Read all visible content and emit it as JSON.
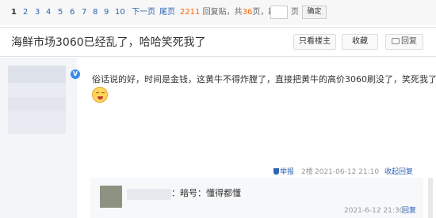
{
  "pager": {
    "pages": [
      "1",
      "2",
      "3",
      "4",
      "5",
      "6",
      "7",
      "8",
      "9",
      "10"
    ],
    "current": "1",
    "next": "下一页",
    "last": "尾页",
    "reply_count": "2211",
    "reply_label": "回复贴，共",
    "page_count": "36",
    "page_label": "页，跳到",
    "jump_value": "",
    "jump_unit": "页",
    "confirm": "确定"
  },
  "thread": {
    "title": "海鲜市场3060已经乱了，哈哈笑死我了",
    "only_author": "只看楼主",
    "favorite": "收藏",
    "reply": "回复"
  },
  "post": {
    "verified_badge": "V",
    "content": "俗话说的好，时间是金钱，这黄牛不得炸膛了，直接把黄牛的高价3060刷没了，笑死我了",
    "emoji_icon": "laughing-face-icon",
    "report": "举报",
    "floor": "2楼",
    "time": "2021-06-12 21:10",
    "collapse_reply": "收起回复"
  },
  "comment": {
    "text": "：暗号：懂得都懂",
    "time": "2021-6-12 21:30",
    "reply": "回复"
  },
  "colors": {
    "link": "#2d64b3",
    "accent": "#ff6600",
    "side_bg": "#f3f5f9"
  }
}
